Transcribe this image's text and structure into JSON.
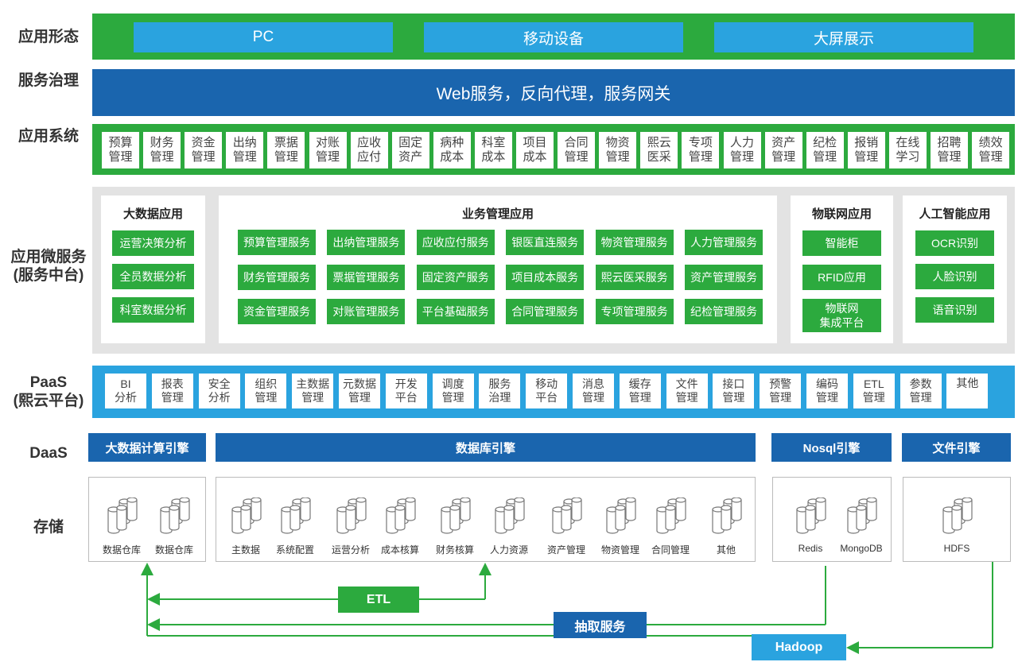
{
  "row_labels": {
    "app_form": "应用形态",
    "service_gov": "服务治理",
    "app_system": "应用系统",
    "microservice_l1": "应用微服务",
    "microservice_l2": "(服务中台)",
    "paas_l1": "PaaS",
    "paas_l2": "(熙云平台)",
    "daas": "DaaS",
    "storage": "存储"
  },
  "app_forms": [
    "PC",
    "移动设备",
    "大屏展示"
  ],
  "service_gov_text": "Web服务，反向代理，服务网关",
  "app_systems": [
    [
      "预算",
      "管理"
    ],
    [
      "财务",
      "管理"
    ],
    [
      "资金",
      "管理"
    ],
    [
      "出纳",
      "管理"
    ],
    [
      "票据",
      "管理"
    ],
    [
      "对账",
      "管理"
    ],
    [
      "应收",
      "应付"
    ],
    [
      "固定",
      "资产"
    ],
    [
      "病种",
      "成本"
    ],
    [
      "科室",
      "成本"
    ],
    [
      "项目",
      "成本"
    ],
    [
      "合同",
      "管理"
    ],
    [
      "物资",
      "管理"
    ],
    [
      "熙云",
      "医采"
    ],
    [
      "专项",
      "管理"
    ],
    [
      "人力",
      "管理"
    ],
    [
      "资产",
      "管理"
    ],
    [
      "纪检",
      "管理"
    ],
    [
      "报销",
      "管理"
    ],
    [
      "在线",
      "学习"
    ],
    [
      "招聘",
      "管理"
    ],
    [
      "绩效",
      "管理"
    ]
  ],
  "bigdata": {
    "title": "大数据应用",
    "items": [
      "运营决策分析",
      "全员数据分析",
      "科室数据分析"
    ]
  },
  "business": {
    "title": "业务管理应用",
    "items": [
      "预算管理服务",
      "出纳管理服务",
      "应收应付服务",
      "银医直连服务",
      "物资管理服务",
      "人力管理服务",
      "财务管理服务",
      "票据管理服务",
      "固定资产服务",
      "项目成本服务",
      "熙云医采服务",
      "资产管理服务",
      "资金管理服务",
      "对账管理服务",
      "平台基础服务",
      "合同管理服务",
      "专项管理服务",
      "纪检管理服务"
    ]
  },
  "iot": {
    "title": "物联网应用",
    "items": [
      [
        "智能柜"
      ],
      [
        "RFID应用"
      ],
      [
        "物联网",
        "集成平台"
      ]
    ]
  },
  "ai": {
    "title": "人工智能应用",
    "items": [
      "OCR识别",
      "人脸识别",
      "语音识别"
    ]
  },
  "paas": [
    [
      "BI",
      "分析"
    ],
    [
      "报表",
      "管理"
    ],
    [
      "安全",
      "分析"
    ],
    [
      "组织",
      "管理"
    ],
    [
      "主数据",
      "管理"
    ],
    [
      "元数据",
      "管理"
    ],
    [
      "开发",
      "平台"
    ],
    [
      "调度",
      "管理"
    ],
    [
      "服务",
      "治理"
    ],
    [
      "移动",
      "平台"
    ],
    [
      "消息",
      "管理"
    ],
    [
      "缓存",
      "管理"
    ],
    [
      "文件",
      "管理"
    ],
    [
      "接口",
      "管理"
    ],
    [
      "预警",
      "管理"
    ],
    [
      "编码",
      "管理"
    ],
    [
      "ETL",
      "管理"
    ],
    [
      "参数",
      "管理"
    ],
    [
      "其他"
    ]
  ],
  "daas": [
    "大数据计算引擎",
    "数据库引擎",
    "Nosql引擎",
    "文件引擎"
  ],
  "storage": {
    "bigdata": [
      "数据仓库",
      "数据仓库"
    ],
    "database": [
      "主数据",
      "系统配置",
      "运营分析",
      "成本核算",
      "财务核算",
      "人力资源",
      "资产管理",
      "物资管理",
      "合同管理",
      "其他"
    ],
    "nosql": [
      "Redis",
      "MongoDB"
    ],
    "file": [
      "HDFS"
    ]
  },
  "flow": {
    "etl": "ETL",
    "extract": "抽取服务",
    "hadoop": "Hadoop"
  },
  "colors": {
    "green": "#2caa3e",
    "blue_dark": "#1a65ae",
    "blue_light": "#2aa3df",
    "grey": "#e3e3e3"
  },
  "icons": {
    "database": "database-cylinders-icon"
  }
}
